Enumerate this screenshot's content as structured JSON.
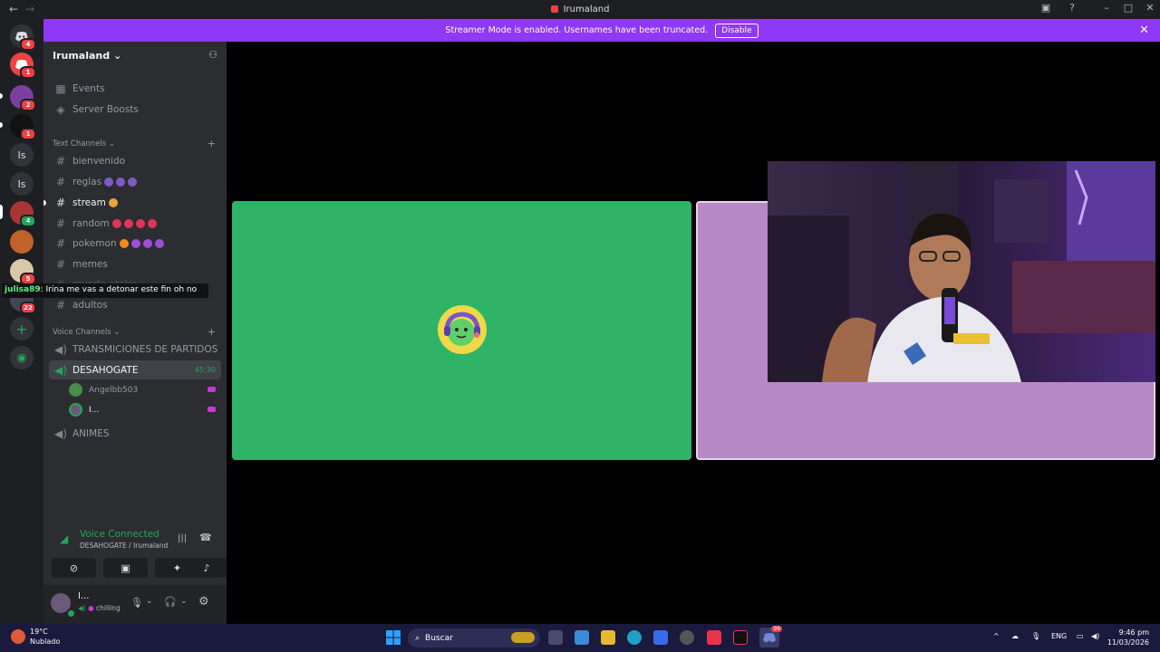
{
  "window": {
    "title": "Irumaland",
    "back": "←",
    "forward": "→"
  },
  "banner": {
    "text": "Streamer Mode is enabled. Usernames have been truncated.",
    "button": "Disable",
    "close": "✕"
  },
  "rail": {
    "badges": [
      "4",
      "1",
      "2",
      "1",
      "4",
      "5",
      "22"
    ],
    "text_servers": [
      "Is",
      "Is"
    ]
  },
  "server": {
    "name": "Irumaland",
    "chevron": "⌄"
  },
  "nav": {
    "events": "Events",
    "boosts": "Server Boosts"
  },
  "text_channels": {
    "category": "Text Channels",
    "items": [
      "bienvenido",
      "reglas",
      "stream",
      "random",
      "pokemon",
      "memes",
      "mundo-otaku",
      "adultos"
    ]
  },
  "chat_overlay": {
    "user": "julisa89",
    "message": ": Irina me vas a detonar este fin oh no"
  },
  "voice_channels": {
    "category": "Voice Channels",
    "items": [
      "TRANSMICIONES DE PARTIDOS",
      "DESAHOGATE",
      "ANIMES"
    ],
    "active_timer": "45:30",
    "users": [
      "Angelbb503",
      "I..."
    ]
  },
  "voice_panel": {
    "status": "Voice Connected",
    "sub": "DESAHOGATE / Irumaland"
  },
  "user_panel": {
    "name": "I...",
    "status": "chilling"
  },
  "taskbar": {
    "weather_temp": "19°C",
    "weather_desc": "Nublado",
    "search_placeholder": "Buscar",
    "lang": "ENG",
    "time": "9:46 pm",
    "date": "11/03/2026",
    "discord_badge": "99"
  },
  "colors": {
    "banner": "#8f38f6",
    "tile_left": "#2fb467",
    "tile_right": "#b88ac5",
    "voice_green": "#23a55a"
  }
}
